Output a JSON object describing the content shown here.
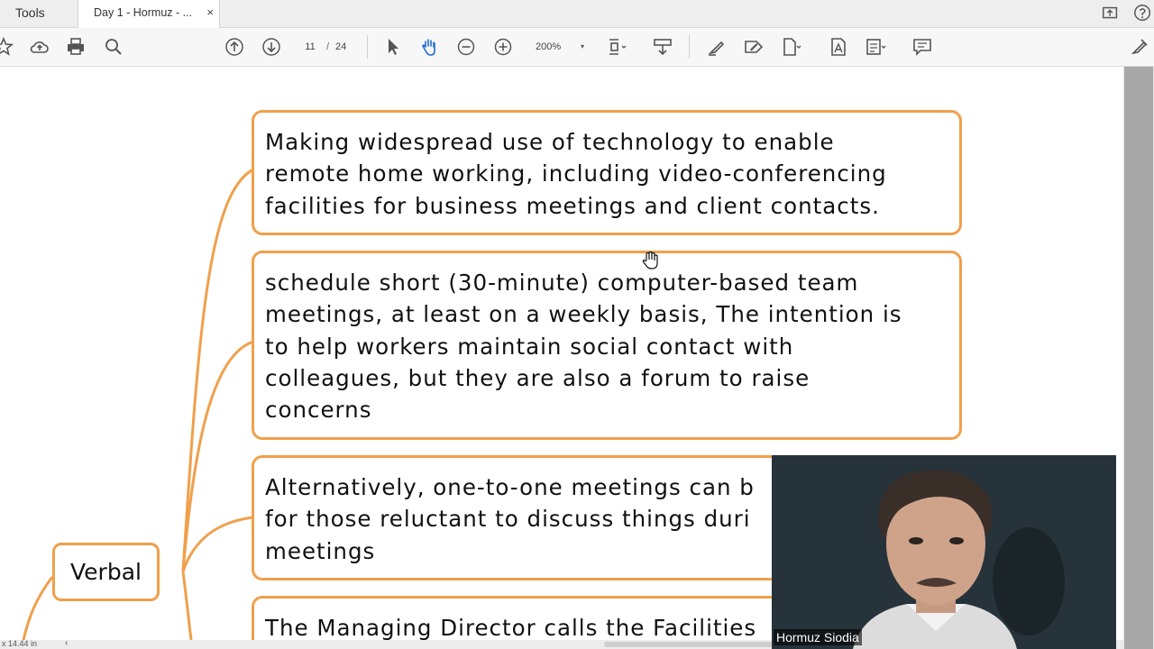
{
  "tabs": {
    "tools_label": "Tools",
    "doc_label": "Day 1 - Hormuz - ...",
    "close_glyph": "×"
  },
  "toolbar": {
    "page_current": "11",
    "page_separator": "/",
    "page_total": "24",
    "zoom_value": "200%",
    "zoom_caret": "▾"
  },
  "mindmap": {
    "root_label": "Verbal",
    "nodes": [
      {
        "lines": [
          "Making widespread use of technology to enable",
          "remote home working, including video-conferencing",
          "facilities for business meetings and client contacts."
        ]
      },
      {
        "lines": [
          "schedule short (30-minute) computer-based team",
          "meetings, at least on a weekly basis, The intention is",
          "to help workers maintain social contact with",
          "colleagues, but they are also a forum to raise",
          "concerns"
        ]
      },
      {
        "lines": [
          "Alternatively, one-to-one meetings can b",
          "for those reluctant to discuss things duri",
          "meetings"
        ]
      },
      {
        "lines": [
          "The Managing Director calls the Facilities"
        ]
      }
    ],
    "accent_color": "#f0a04b"
  },
  "webcam": {
    "name": "Hormuz Siodia"
  },
  "status": {
    "page_size": "x 14.44 in",
    "scroll_left": "‹"
  }
}
